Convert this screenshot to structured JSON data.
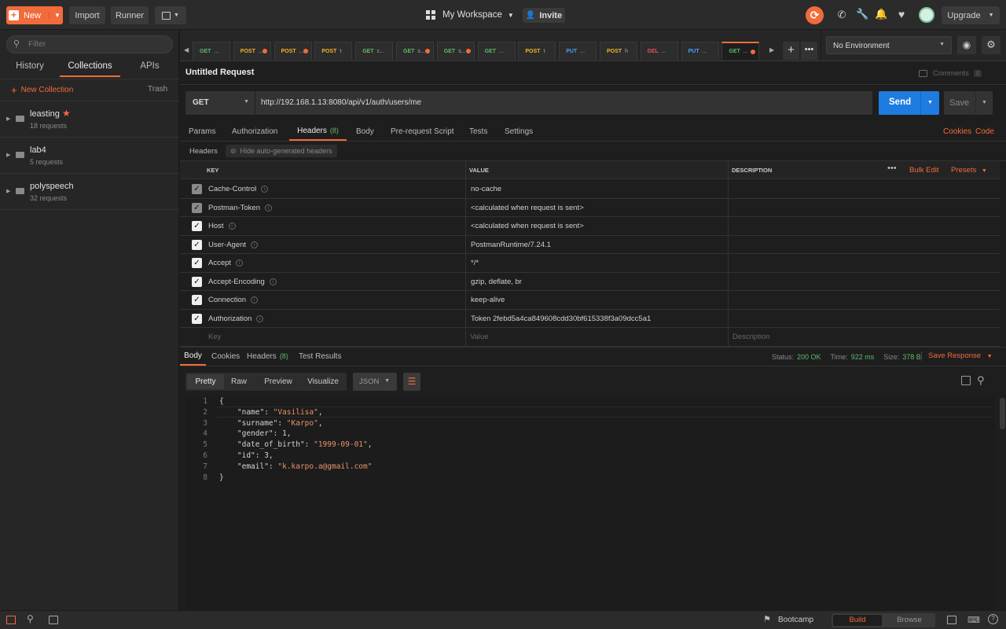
{
  "topbar": {
    "new_label": "New",
    "import_label": "Import",
    "runner_label": "Runner",
    "workspace_label": "My Workspace",
    "invite_label": "Invite",
    "upgrade_label": "Upgrade"
  },
  "sidebar": {
    "filter_placeholder": "Filter",
    "tabs": [
      "History",
      "Collections",
      "APIs"
    ],
    "new_collection_label": "New Collection",
    "trash_label": "Trash",
    "collections": [
      {
        "name": "leasting",
        "count": "18 requests"
      },
      {
        "name": "lab4",
        "count": "5 requests"
      },
      {
        "name": "polyspeech",
        "count": "32 requests"
      }
    ]
  },
  "request_tabs": [
    {
      "method": "GET",
      "name": "...",
      "dirty": false
    },
    {
      "method": "POST",
      "name": "...",
      "dirty": true
    },
    {
      "method": "POST",
      "name": "...",
      "dirty": true
    },
    {
      "method": "POST",
      "name": "t",
      "dirty": false
    },
    {
      "method": "GET",
      "name": "c...",
      "dirty": false
    },
    {
      "method": "GET",
      "name": "s...",
      "dirty": true
    },
    {
      "method": "GET",
      "name": "s...",
      "dirty": true
    },
    {
      "method": "GET",
      "name": "...",
      "dirty": false
    },
    {
      "method": "POST",
      "name": "t",
      "dirty": false
    },
    {
      "method": "PUT",
      "name": "...",
      "dirty": false
    },
    {
      "method": "POST",
      "name": "h",
      "dirty": false
    },
    {
      "method": "DEL",
      "name": "...",
      "dirty": false
    },
    {
      "method": "PUT",
      "name": "...",
      "dirty": false
    },
    {
      "method": "GET",
      "name": "...",
      "dirty": true
    }
  ],
  "environment": {
    "selected": "No Environment"
  },
  "request": {
    "title": "Untitled Request",
    "comments_label": "Comments",
    "comments_count": "0",
    "method": "GET",
    "url": "http://192.168.1.13:8080/api/v1/auth/users/me",
    "send_label": "Send",
    "save_label": "Save"
  },
  "request_subtabs": {
    "params": "Params",
    "authorization": "Authorization",
    "headers": "Headers",
    "headers_count": "(8)",
    "body": "Body",
    "prerequest": "Pre-request Script",
    "tests": "Tests",
    "settings": "Settings",
    "cookies": "Cookies",
    "code": "Code"
  },
  "headers_section": {
    "label": "Headers",
    "hide_label": "Hide auto-generated headers",
    "col_key": "KEY",
    "col_value": "VALUE",
    "col_description": "DESCRIPTION",
    "bulk_edit": "Bulk Edit",
    "presets": "Presets",
    "rows": [
      {
        "key": "Cache-Control",
        "value": "no-cache",
        "auto": true
      },
      {
        "key": "Postman-Token",
        "value": "<calculated when request is sent>",
        "auto": true
      },
      {
        "key": "Host",
        "value": "<calculated when request is sent>",
        "auto": false
      },
      {
        "key": "User-Agent",
        "value": "PostmanRuntime/7.24.1",
        "auto": false
      },
      {
        "key": "Accept",
        "value": "*/*",
        "auto": false
      },
      {
        "key": "Accept-Encoding",
        "value": "gzip, deflate, br",
        "auto": false
      },
      {
        "key": "Connection",
        "value": "keep-alive",
        "auto": false
      },
      {
        "key": "Authorization",
        "value": "Token 2febd5a4ca849608cdd30bf615338f3a09dcc5a1",
        "auto": false
      }
    ],
    "placeholder_key": "Key",
    "placeholder_value": "Value",
    "placeholder_description": "Description"
  },
  "response": {
    "tabs": {
      "body": "Body",
      "cookies": "Cookies",
      "headers": "Headers",
      "headers_count": "(8)",
      "test_results": "Test Results"
    },
    "status_label": "Status:",
    "status_value": "200 OK",
    "time_label": "Time:",
    "time_value": "922 ms",
    "size_label": "Size:",
    "size_value": "378 B",
    "save_response": "Save Response",
    "view_tabs": [
      "Pretty",
      "Raw",
      "Preview",
      "Visualize"
    ],
    "format": "JSON",
    "body_lines": [
      {
        "n": "1",
        "parts": [
          [
            "p",
            "{"
          ]
        ]
      },
      {
        "n": "2",
        "parts": [
          [
            "p",
            "    \"name\": "
          ],
          [
            "s",
            "\"Vasilisa\""
          ],
          [
            "p",
            ","
          ]
        ]
      },
      {
        "n": "3",
        "parts": [
          [
            "p",
            "    \"surname\": "
          ],
          [
            "s",
            "\"Karpo\""
          ],
          [
            "p",
            ","
          ]
        ]
      },
      {
        "n": "4",
        "parts": [
          [
            "p",
            "    \"gender\": 1,"
          ]
        ]
      },
      {
        "n": "5",
        "parts": [
          [
            "p",
            "    \"date_of_birth\": "
          ],
          [
            "s",
            "\"1999-09-01\""
          ],
          [
            "p",
            ","
          ]
        ]
      },
      {
        "n": "6",
        "parts": [
          [
            "p",
            "    \"id\": 3,"
          ]
        ]
      },
      {
        "n": "7",
        "parts": [
          [
            "p",
            "    \"email\": "
          ],
          [
            "s",
            "\"k.karpo.a@gmail.com\""
          ]
        ]
      },
      {
        "n": "8",
        "parts": [
          [
            "p",
            "}"
          ]
        ]
      }
    ]
  },
  "statusbar": {
    "bootcamp": "Bootcamp",
    "build": "Build",
    "browse": "Browse"
  },
  "colors": {
    "accent": "#f26b3a",
    "send_blue": "#1e7ce0",
    "success": "#5fb86a"
  }
}
